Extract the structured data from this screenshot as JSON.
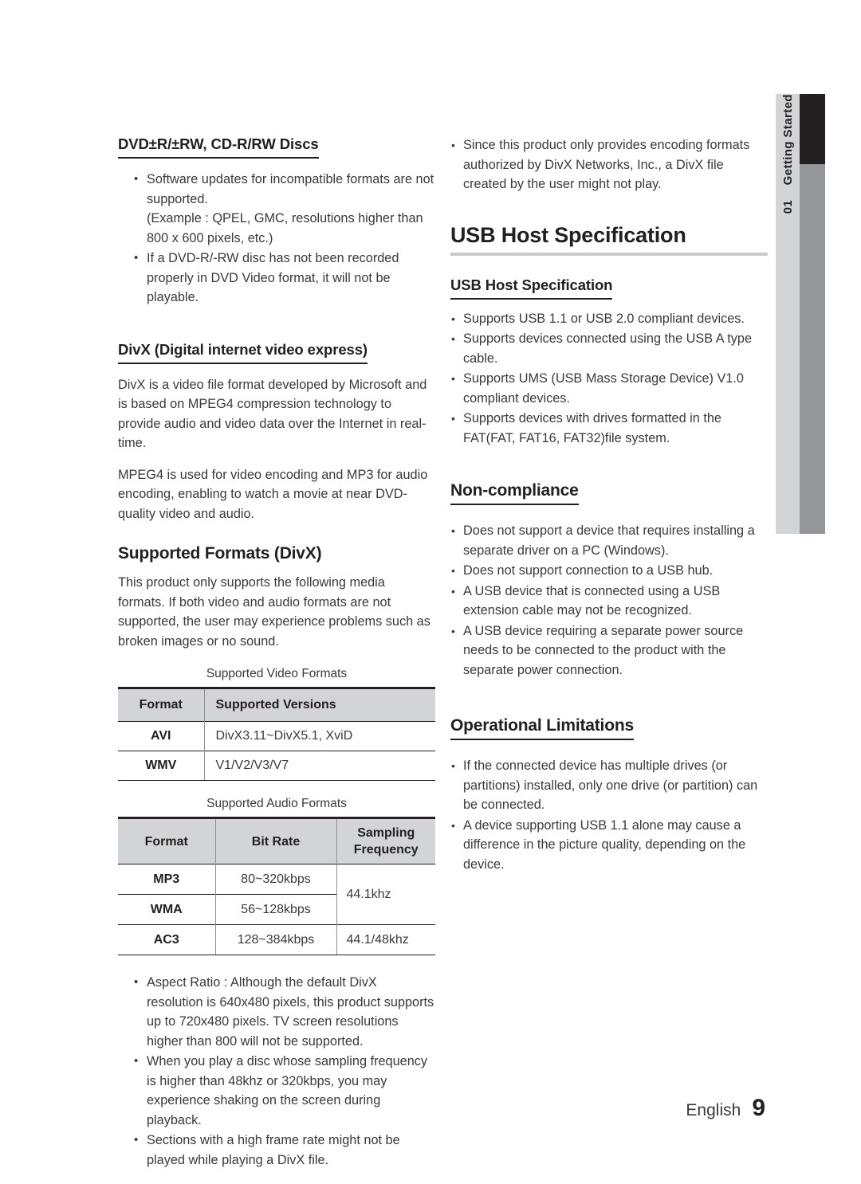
{
  "side_tab": {
    "number": "01",
    "label": "Getting Started"
  },
  "footer": {
    "language": "English",
    "page_number": "9"
  },
  "left_column": {
    "disc_heading": "DVD±R/±RW, CD-R/RW Discs",
    "disc_bullets": [
      "Software updates for incompatible formats are not supported.",
      "If a DVD-R/-RW disc has not been recorded properly in DVD Video format, it will not be playable."
    ],
    "disc_bullet_1_note": "(Example : QPEL, GMC, resolutions higher than 800 x 600 pixels, etc.)",
    "divx_heading": "DivX (Digital internet video express)",
    "divx_paragraphs": [
      "DivX is a video file format developed by Microsoft and is based on MPEG4 compression technology to provide audio and video data over the Internet in real-time.",
      "MPEG4 is used for video encoding and MP3 for audio encoding, enabling to watch a movie at near DVD-quality video and audio."
    ],
    "supported_formats_heading": "Supported Formats (DivX)",
    "supported_formats_intro": "This product only supports the following media formats. If both video and audio formats are not supported, the user may experience problems such as broken images or no sound.",
    "video_table": {
      "caption": "Supported Video Formats",
      "headers": [
        "Format",
        "Supported Versions"
      ],
      "rows": [
        [
          "AVI",
          "DivX3.11~DivX5.1, XviD"
        ],
        [
          "WMV",
          "V1/V2/V3/V7"
        ]
      ]
    },
    "audio_table": {
      "caption": "Supported Audio Formats",
      "headers": [
        "Format",
        "Bit Rate",
        "Sampling\nFrequency"
      ],
      "header_sampling_line1": "Sampling",
      "header_sampling_line2": "Frequency",
      "rows": [
        {
          "format": "MP3",
          "bit_rate": "80~320kbps",
          "sampling": "44.1khz"
        },
        {
          "format": "WMA",
          "bit_rate": "56~128kbps",
          "sampling": ""
        },
        {
          "format": "AC3",
          "bit_rate": "128~384kbps",
          "sampling": "44.1/48khz"
        }
      ]
    },
    "closing_bullets": [
      "Aspect Ratio : Although the default DivX resolution is 640x480 pixels, this product supports up to 720x480 pixels. TV screen resolutions higher than 800 will not be supported.",
      "When you play a disc whose sampling frequency is higher than 48khz or 320kbps, you may experience shaking on the screen during playback.",
      "Sections with a high frame rate might not be played while playing a DivX file."
    ]
  },
  "right_column": {
    "top_bullet": "Since this product only provides encoding formats authorized by DivX Networks, Inc., a DivX file created by the user might not play.",
    "usb_section_title": "USB Host Specification",
    "usb_sub_heading": "USB Host Specification",
    "usb_bullets": [
      "Supports USB 1.1 or USB 2.0 compliant devices.",
      "Supports devices connected using the USB A type cable.",
      "Supports UMS (USB Mass Storage Device) V1.0 compliant devices.",
      "Supports devices with drives formatted in the FAT(FAT, FAT16, FAT32)file system."
    ],
    "noncompliance_heading": "Non-compliance",
    "noncompliance_bullets": [
      "Does not support a device that requires installing a separate driver on a PC (Windows).",
      "Does not support connection to a USB hub.",
      "A USB device that is connected using a USB extension cable may not be recognized.",
      "A USB device requiring a separate power source needs to be connected to the product with the separate power connection."
    ],
    "operational_heading": "Operational Limitations",
    "operational_bullets": [
      "If the connected device has multiple drives (or partitions) installed, only one drive (or partition) can be connected.",
      "A device supporting USB 1.1 alone may cause a difference in the picture quality, depending on the device."
    ]
  }
}
